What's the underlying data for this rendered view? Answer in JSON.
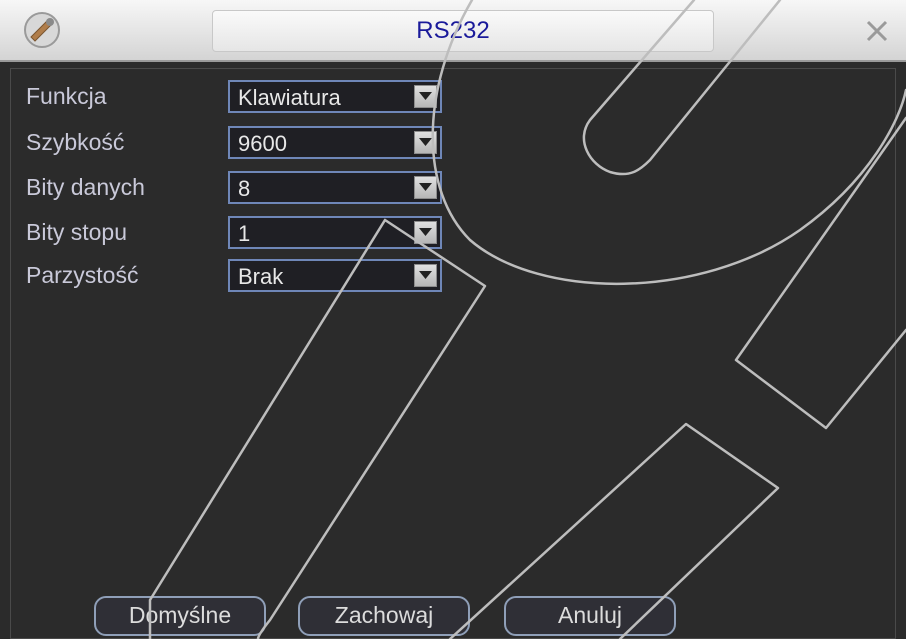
{
  "window": {
    "title": "RS232"
  },
  "form": {
    "rows": [
      {
        "label": "Funkcja",
        "value": "Klawiatura"
      },
      {
        "label": "Szybkość",
        "value": "9600"
      },
      {
        "label": "Bity danych",
        "value": "8"
      },
      {
        "label": "Bity stopu",
        "value": "1"
      },
      {
        "label": "Parzystość",
        "value": "Brak"
      }
    ]
  },
  "buttons": {
    "default_label": "Domyślne",
    "save_label": "Zachowaj",
    "cancel_label": "Anuluj"
  },
  "icons": {
    "app": "settings-tool-icon",
    "close": "close-icon",
    "dropdown": "chevron-down-icon"
  },
  "colors": {
    "background": "#2b2b2b",
    "title_text": "#1a1a9a",
    "label_text": "#c9c9d9",
    "field_border": "#6f87b8"
  }
}
